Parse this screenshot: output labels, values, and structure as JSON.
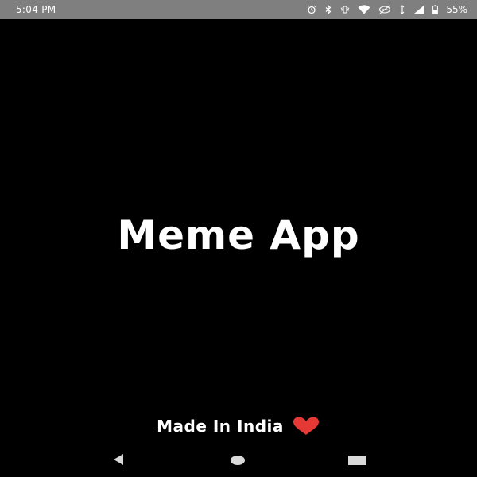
{
  "status_bar": {
    "time": "5:04 PM",
    "battery": "55%",
    "icons": [
      "alarm-icon",
      "bluetooth-icon",
      "wifi-icon",
      "data-saver-icon",
      "vibrate-icon",
      "signal-icon",
      "battery-icon"
    ]
  },
  "app": {
    "title": "Meme App",
    "footer_text": "Made In India"
  },
  "nav_bar": {
    "buttons": [
      "back-icon",
      "home-icon",
      "recents-icon"
    ]
  },
  "colors": {
    "background": "#000000",
    "status_bar": "#7f7f7f",
    "text": "#ffffff",
    "heart": "#e53935",
    "nav_icons": "#d9d9d9"
  }
}
